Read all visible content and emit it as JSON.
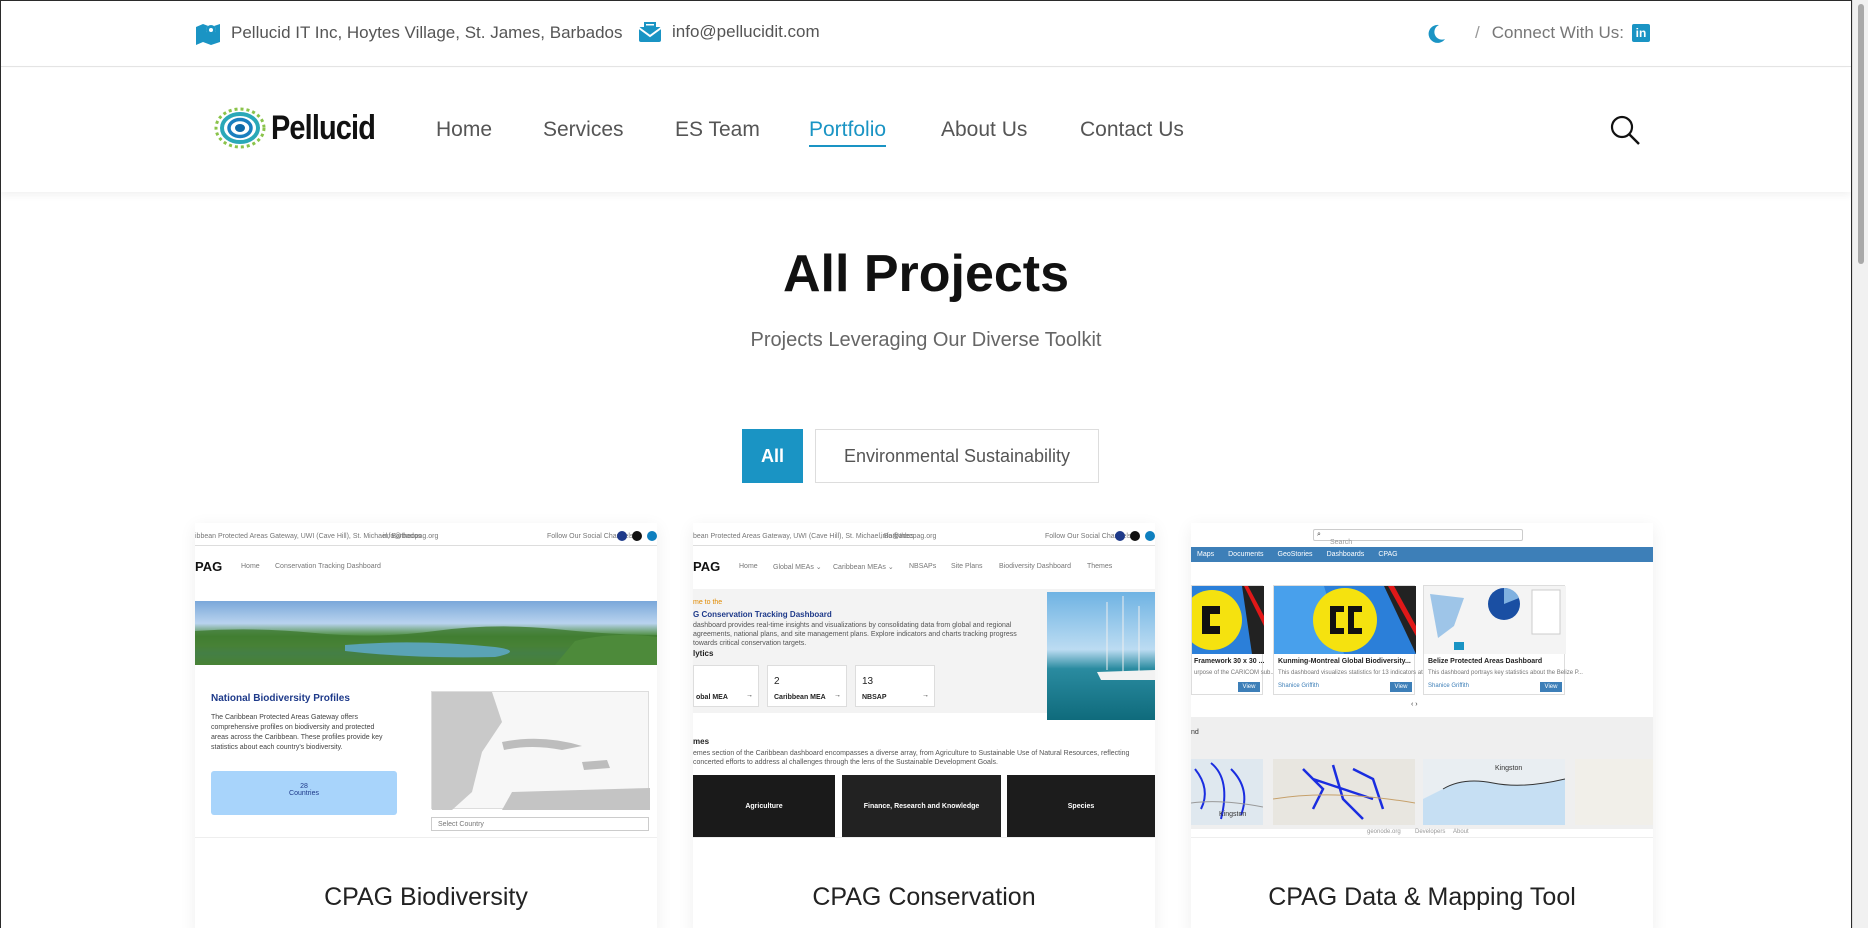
{
  "topbar": {
    "address": "Pellucid IT Inc, Hoytes Village, St. James, Barbados",
    "email": "info@pellucidit.com",
    "slash": "/",
    "connect": "Connect With Us:",
    "linkedin": "in"
  },
  "brand": {
    "name": "Pellucid"
  },
  "nav": {
    "items": [
      "Home",
      "Services",
      "ES Team",
      "Portfolio",
      "About Us",
      "Contact Us"
    ],
    "active": "Portfolio"
  },
  "hero": {
    "title": "All Projects",
    "subtitle": "Projects Leveraging Our Diverse Toolkit"
  },
  "filters": [
    "All",
    "Environmental Sustainability"
  ],
  "cards": [
    {
      "title": "CPAG Biodiversity",
      "shot": {
        "header": "ibbean Protected Areas Gateway, UWI (Cave Hill), St. Michael, Barbados",
        "email": "info@thecpag.org",
        "follow": "Follow Our Social Channels",
        "brand": "PAG",
        "menu": [
          "Home",
          "Conservation Tracking Dashboard"
        ],
        "heading": "National Biodiversity Profiles",
        "body": "The Caribbean Protected Areas Gateway offers comprehensive profiles on biodiversity and protected areas across the Caribbean. These profiles provide key statistics about each country's biodiversity.",
        "stat_value": "28",
        "stat_label": "Countries",
        "select": "Select Country"
      }
    },
    {
      "title": "CPAG Conservation",
      "shot": {
        "header": "bean Protected Areas Gateway, UWI (Cave Hill), St. Michael, Barbados",
        "email": "info@thecpag.org",
        "follow": "Follow Our Social Channels",
        "brand": "PAG",
        "menu": [
          "Home",
          "Global MEAs ⌄",
          "Caribbean MEAs ⌄",
          "NBSAPs",
          "Site Plans",
          "Biodiversity Dashboard",
          "Themes"
        ],
        "kicker": "me to the",
        "heading": "G Conservation Tracking Dashboard",
        "body": "dashboard provides real-time insights and visualizations by consolidating data from global and regional agreements, national plans, and site management plans. Explore indicators and charts tracking progress towards critical conservation targets.",
        "section": "lytics",
        "stats": [
          {
            "value": "",
            "label": "obal MEA"
          },
          {
            "value": "2",
            "label": "Caribbean MEA"
          },
          {
            "value": "13",
            "label": "NBSAP"
          }
        ],
        "themes_heading": "mes",
        "themes_body": "emes section of the Caribbean dashboard encompasses a diverse array, from Agriculture to Sustainable Use of Natural Resources, reflecting concerted efforts to address al challenges through the lens of the Sustainable Development Goals.",
        "tiles": [
          "Agriculture",
          "Finance, Research and Knowledge",
          "Species"
        ]
      }
    },
    {
      "title": "CPAG Data & Mapping Tool",
      "shot": {
        "search": "Search",
        "menu": [
          "Maps",
          "Documents",
          "GeoStories",
          "Dashboards",
          "CPAG"
        ],
        "cards": [
          {
            "title": "Framework 30 x 30 ...",
            "desc": "urpose of the CARICOM sub...",
            "user": ""
          },
          {
            "title": "Kunming-Montreal Global Biodiversity...",
            "desc": "This dashboard visualizes statistics for 13 indicators at the...",
            "user": "Shanice Griffith"
          },
          {
            "title": "Belize Protected Areas Dashboard",
            "desc": "This dashboard portrays key statistics about the Belize P...",
            "user": "Shanice Griffith"
          }
        ],
        "view": "View",
        "pager": "‹  ›",
        "map_label": "nd",
        "kingston_a": "Kingston",
        "kingston_b": "Kingston",
        "footer": [
          "geonode.org",
          "Developers",
          "About"
        ]
      }
    }
  ],
  "colors": {
    "accent": "#1a94c4",
    "nav_bar_blue": "#3d7fb8"
  }
}
